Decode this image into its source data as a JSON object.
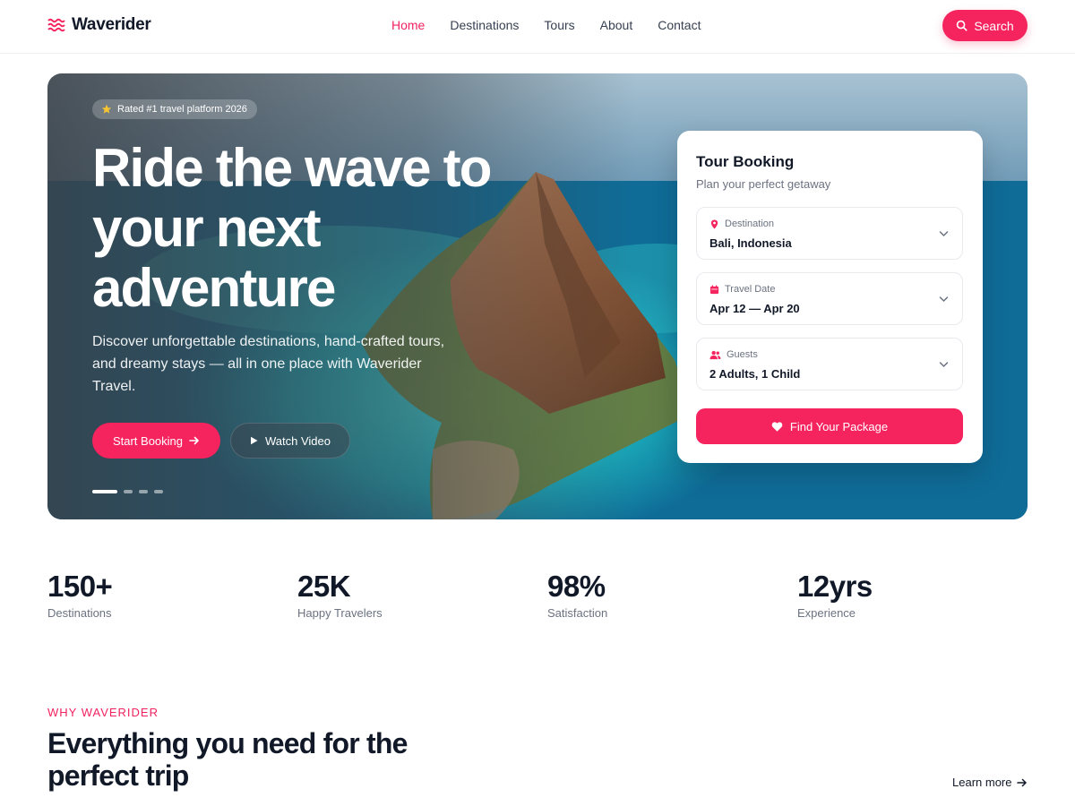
{
  "brand": {
    "name": "Waverider",
    "accent": "#f5245f",
    "icon": "waves-icon"
  },
  "nav": {
    "links": [
      {
        "label": "Home",
        "active": true
      },
      {
        "label": "Destinations",
        "active": false
      },
      {
        "label": "Tours",
        "active": false
      },
      {
        "label": "About",
        "active": false
      },
      {
        "label": "Contact",
        "active": false
      }
    ],
    "search_label": "Search"
  },
  "hero": {
    "badge": "Rated #1 travel platform 2026",
    "title": "Ride the wave to your next adventure",
    "subtitle": "Discover unforgettable destinations, hand-crafted tours, and dreamy stays — all in one place with Waverider Travel.",
    "primary_cta": "Start Booking",
    "secondary_cta": "Watch Video",
    "slides": {
      "count": 4,
      "active_index": 0
    }
  },
  "booking": {
    "title": "Tour Booking",
    "subtitle": "Plan your perfect getaway",
    "fields": [
      {
        "label": "Destination",
        "value": "Bali, Indonesia",
        "icon": "map-pin-icon"
      },
      {
        "label": "Travel Date",
        "value": "Apr 12 — Apr 20",
        "icon": "calendar-icon"
      },
      {
        "label": "Guests",
        "value": "2 Adults, 1 Child",
        "icon": "users-icon"
      }
    ],
    "submit_label": "Find Your Package"
  },
  "stats": [
    {
      "value": "150+",
      "label": "Destinations"
    },
    {
      "value": "25K",
      "label": "Happy Travelers"
    },
    {
      "value": "98%",
      "label": "Satisfaction"
    },
    {
      "value": "12yrs",
      "label": "Experience"
    }
  ],
  "why": {
    "eyebrow": "WHY WAVERIDER",
    "title": "Everything you need for the perfect trip",
    "link": "Learn more"
  }
}
